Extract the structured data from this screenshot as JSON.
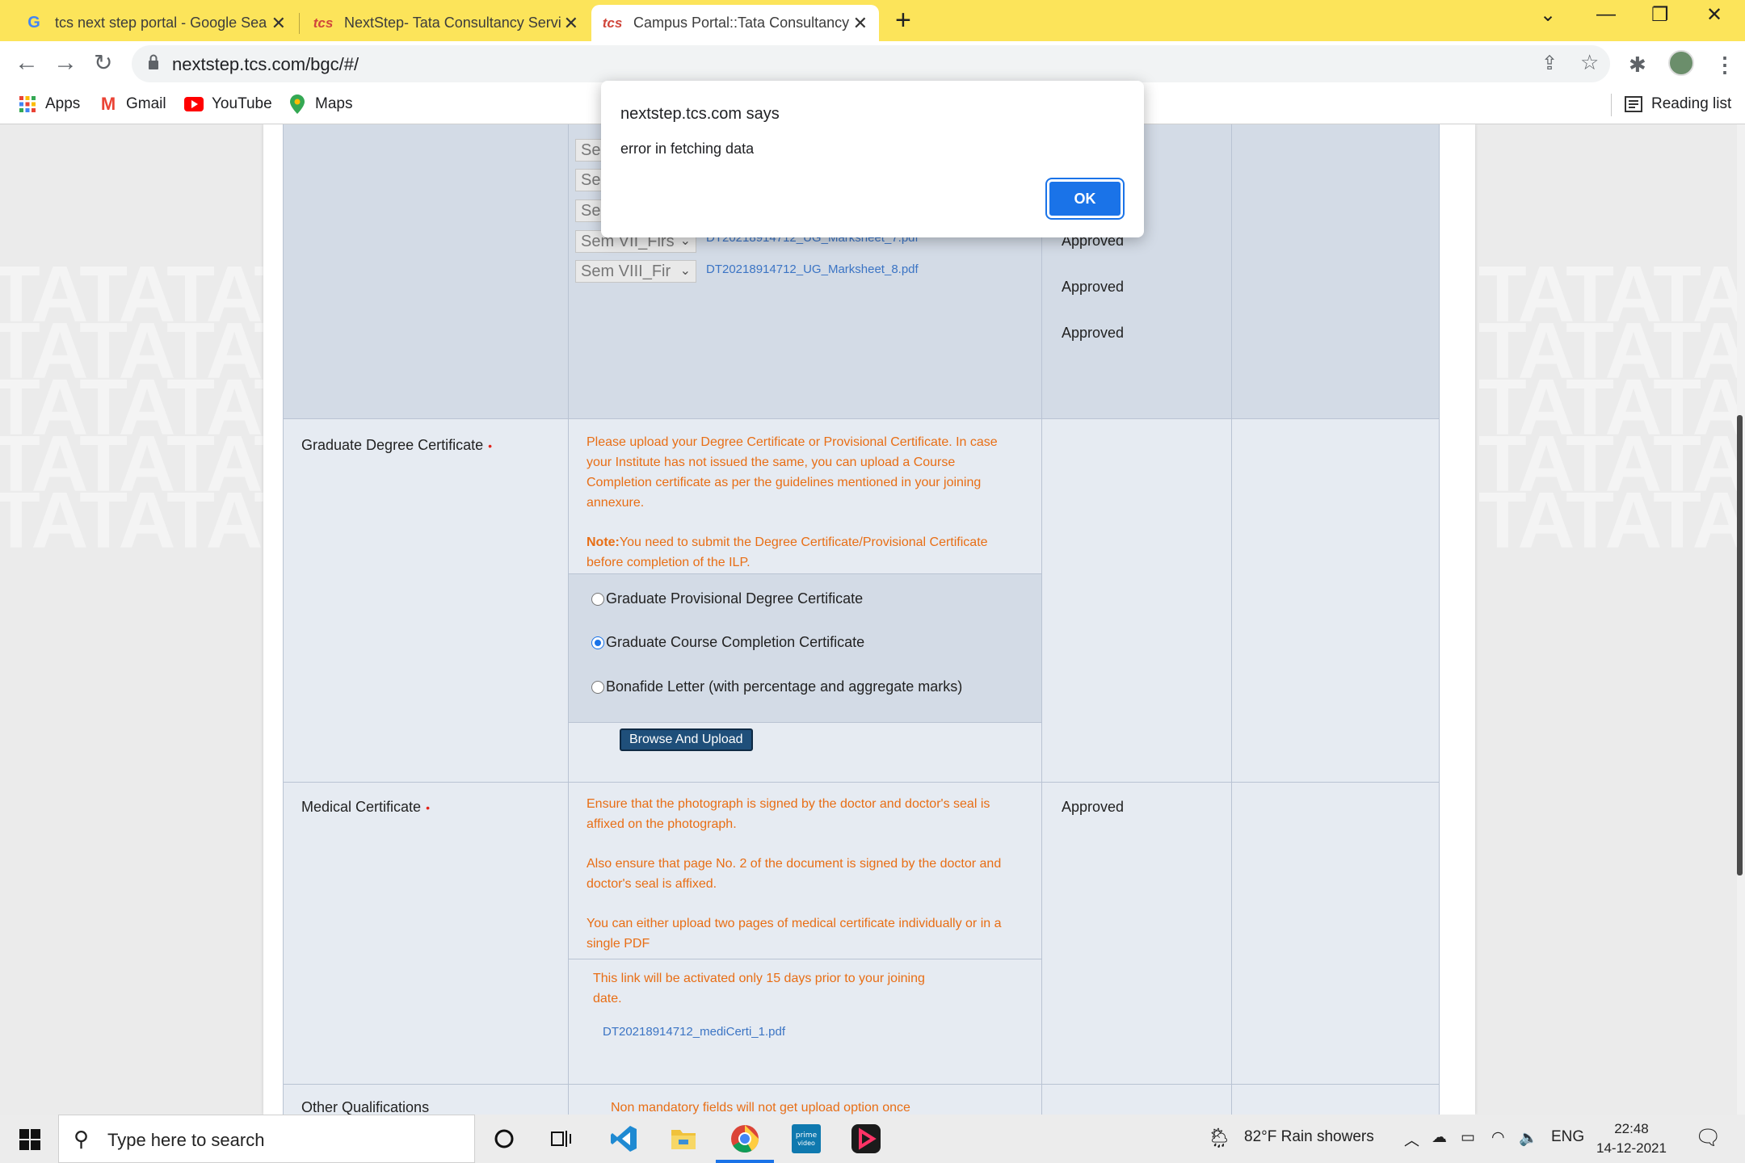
{
  "browser": {
    "tabs": [
      {
        "title": "tcs next step portal - Google Sea",
        "favicon": "google-g-icon"
      },
      {
        "title": "NextStep- Tata Consultancy Servi",
        "favicon": "tcs-icon"
      },
      {
        "title": "Campus Portal::Tata Consultancy",
        "favicon": "tcs-icon",
        "active": true
      }
    ],
    "url": "nextstep.tcs.com/bgc/#/",
    "bookmarks": [
      "Apps",
      "Gmail",
      "YouTube",
      "Maps"
    ],
    "reading_list": "Reading list"
  },
  "dialog": {
    "heading": "nextstep.tcs.com says",
    "message": "error in fetching data",
    "ok_label": "OK"
  },
  "watermark_text": "TATATAT",
  "marksheets": {
    "visible_selects": [
      "Se",
      "Se",
      "Se",
      "Sem VII_Firs",
      "Sem VIII_Fir"
    ],
    "files": [
      "DT20218914712_UG_Marksheet_7.pdf",
      "DT20218914712_UG_Marksheet_8.pdf"
    ],
    "statuses": [
      "Approved",
      "Approved",
      "Approved"
    ]
  },
  "graduate_degree": {
    "label": "Graduate Degree Certificate",
    "instruction": "Please upload your Degree Certificate or Provisional Certificate. In case your Institute has not issued the same, you can upload a Course Completion certificate as per the guidelines mentioned in your joining annexure.",
    "note_label": "Note:",
    "note_text": "You need to submit the Degree Certificate/Provisional Certificate before completion of the ILP.",
    "options": [
      {
        "label": "Graduate Provisional Degree Certificate",
        "selected": false
      },
      {
        "label": "Graduate Course Completion Certificate",
        "selected": true
      },
      {
        "label": "Bonafide Letter (with percentage and aggregate marks)",
        "selected": false
      }
    ],
    "upload_button": "Browse And Upload"
  },
  "medical": {
    "label": "Medical Certificate",
    "instruction_1": "Ensure that the photograph is signed by the doctor and doctor's seal is affixed on the photograph.",
    "instruction_2": "Also ensure that page No. 2 of the document is signed by the doctor and doctor's seal is affixed.",
    "instruction_3": "You can either upload two pages of medical certificate individually or in a single PDF",
    "activation_note": "This link will be activated only 15 days prior to your joining date.",
    "file": "DT20218914712_mediCerti_1.pdf",
    "status": "Approved"
  },
  "other_qualifications": {
    "label": "Other Qualifications",
    "note": "Non mandatory fields will not get upload option once"
  },
  "taskbar": {
    "search_placeholder": "Type here to search",
    "weather": "82°F  Rain showers",
    "language": "ENG",
    "time": "22:48",
    "date": "14-12-2021"
  }
}
